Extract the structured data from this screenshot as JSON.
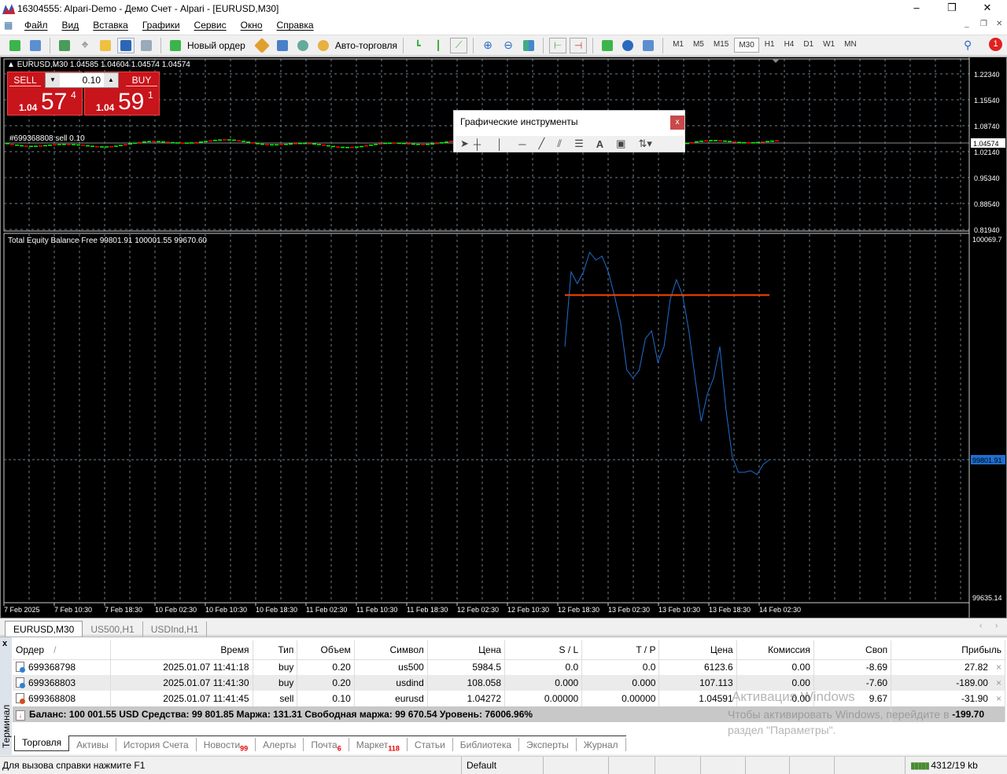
{
  "window": {
    "title": "16304555: Alpari-Demo - Демо Счет - Alpari - [EURUSD,M30]"
  },
  "menu": [
    "Файл",
    "Вид",
    "Вставка",
    "Графики",
    "Сервис",
    "Окно",
    "Справка"
  ],
  "toolbar": {
    "new_order": "Новый ордер",
    "auto_trading": "Авто-торговля",
    "timeframes": [
      "M1",
      "M5",
      "M15",
      "M30",
      "H1",
      "H4",
      "D1",
      "W1",
      "MN"
    ],
    "active_timeframe": "M30",
    "notification_count": "1"
  },
  "chart": {
    "header": "EURUSD,M30  1.04585 1.04604 1.04574 1.04574",
    "one_click": {
      "sell": "SELL",
      "buy": "BUY",
      "volume": "0.10",
      "sell_big": "1.04",
      "sell_pips": "57",
      "sell_frac": "4",
      "buy_big": "1.04",
      "buy_pips": "59",
      "buy_frac": "1"
    },
    "order_label": "#699368808 sell 0.10",
    "price_axis": [
      "1.22340",
      "1.15540",
      "1.08740",
      "1.02140",
      "0.95340",
      "0.88540",
      "0.81940"
    ],
    "current_price": "1.04574",
    "indicator_label": "Total Equity Balance Free 99801.91 100001.55 99670.60",
    "indicator_axis_top": "100069.7",
    "indicator_axis_bottom": "99635.14",
    "indicator_current": "99801.91",
    "time_axis": [
      "7 Feb 2025",
      "7 Feb 10:30",
      "7 Feb 18:30",
      "10 Feb 02:30",
      "10 Feb 10:30",
      "10 Feb 18:30",
      "11 Feb 02:30",
      "11 Feb 10:30",
      "11 Feb 18:30",
      "12 Feb 02:30",
      "12 Feb 10:30",
      "12 Feb 18:30",
      "13 Feb 02:30",
      "13 Feb 10:30",
      "13 Feb 18:30",
      "14 Feb 02:30"
    ],
    "colors": {
      "bull": "#00ff00",
      "bear": "#ff0000",
      "equity": "#1e6fd0",
      "balance": "#ff4500",
      "grid": "#6e7f8f"
    }
  },
  "chart_data": {
    "type": "line",
    "ylim": [
      99635.14,
      100069.7
    ],
    "series": [
      {
        "name": "Equity",
        "values": [
          99939.1,
          100029.7,
          100015.4,
          100029.7,
          100053.5,
          100044.0,
          100048.7,
          100029.7,
          100001.1,
          99967.7,
          99910.5,
          99901.0,
          99910.5,
          99948.7,
          99958.2,
          99920.1,
          99939.1,
          99996.3,
          100020.1,
          100001.1,
          99958.2,
          99901.0,
          99848.6,
          99882.0,
          99901.0,
          99939.1,
          99862.9,
          99805.7,
          99786.7,
          99786.7,
          99788.6,
          99783.8,
          99796.2,
          99801.9
        ]
      },
      {
        "name": "Balance",
        "values": [
          100001.55,
          100001.55
        ]
      }
    ]
  },
  "drawing_tools": {
    "title": "Графические инструменты",
    "close": "x"
  },
  "chart_tabs": [
    "EURUSD,M30",
    "US500,H1",
    "USDInd,H1"
  ],
  "terminal": {
    "side_label": "Терминал",
    "columns": [
      "Ордер",
      "Время",
      "Тип",
      "Объем",
      "Символ",
      "Цена",
      "S / L",
      "T / P",
      "Цена",
      "Комиссия",
      "Своп",
      "Прибыль"
    ],
    "rows": [
      [
        "699368798",
        "2025.01.07 11:41:18",
        "buy",
        "0.20",
        "us500",
        "5984.5",
        "0.0",
        "0.0",
        "6123.6",
        "0.00",
        "-8.69",
        "27.82"
      ],
      [
        "699368803",
        "2025.01.07 11:41:30",
        "buy",
        "0.20",
        "usdind",
        "108.058",
        "0.000",
        "0.000",
        "107.113",
        "0.00",
        "-7.60",
        "-189.00"
      ],
      [
        "699368808",
        "2025.01.07 11:41:45",
        "sell",
        "0.10",
        "eurusd",
        "1.04272",
        "0.00000",
        "0.00000",
        "1.04591",
        "0.00",
        "9.67",
        "-31.90"
      ]
    ],
    "summary": "Баланс: 100 001.55 USD  Средства: 99 801.85  Маржа: 131.31  Свободная маржа: 99 670.54  Уровень: 76006.96%",
    "total_profit": "-199.70",
    "tabs": [
      {
        "label": "Торговля"
      },
      {
        "label": "Активы"
      },
      {
        "label": "История Счета"
      },
      {
        "label": "Новости",
        "badge": "99"
      },
      {
        "label": "Алерты"
      },
      {
        "label": "Почта",
        "badge": "6"
      },
      {
        "label": "Маркет",
        "badge": "118"
      },
      {
        "label": "Статьи"
      },
      {
        "label": "Библиотека"
      },
      {
        "label": "Эксперты"
      },
      {
        "label": "Журнал"
      }
    ]
  },
  "watermark": {
    "line1": "Активация Windows",
    "line2": "Чтобы активировать Windows, перейдите в",
    "line3": "раздел \"Параметры\"."
  },
  "status": {
    "help": "Для вызова справки нажмите F1",
    "profile": "Default",
    "traffic": "4312/19 kb"
  }
}
